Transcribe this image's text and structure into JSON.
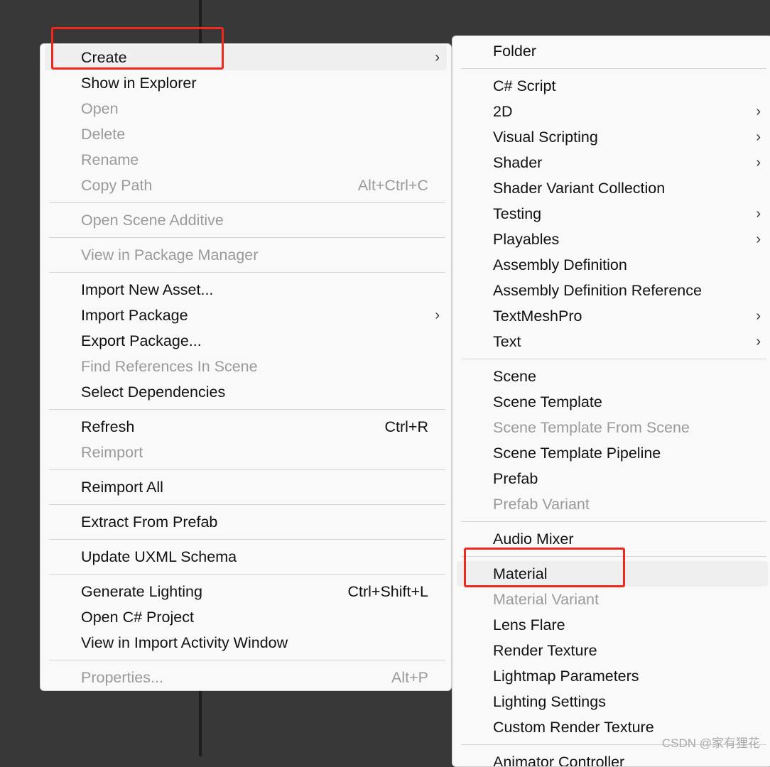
{
  "left_menu": {
    "items": [
      {
        "label": "Create",
        "arrow": true,
        "highlight": true
      },
      {
        "label": "Show in Explorer"
      },
      {
        "label": "Open",
        "disabled": true
      },
      {
        "label": "Delete",
        "disabled": true
      },
      {
        "label": "Rename",
        "disabled": true
      },
      {
        "label": "Copy Path",
        "shortcut": "Alt+Ctrl+C",
        "disabled": true
      },
      {
        "sep": true
      },
      {
        "label": "Open Scene Additive",
        "disabled": true
      },
      {
        "sep": true
      },
      {
        "label": "View in Package Manager",
        "disabled": true
      },
      {
        "sep": true
      },
      {
        "label": "Import New Asset..."
      },
      {
        "label": "Import Package",
        "arrow": true
      },
      {
        "label": "Export Package..."
      },
      {
        "label": "Find References In Scene",
        "disabled": true
      },
      {
        "label": "Select Dependencies"
      },
      {
        "sep": true
      },
      {
        "label": "Refresh",
        "shortcut": "Ctrl+R"
      },
      {
        "label": "Reimport",
        "disabled": true
      },
      {
        "sep": true
      },
      {
        "label": "Reimport All"
      },
      {
        "sep": true
      },
      {
        "label": "Extract From Prefab"
      },
      {
        "sep": true
      },
      {
        "label": "Update UXML Schema"
      },
      {
        "sep": true
      },
      {
        "label": "Generate Lighting",
        "shortcut": "Ctrl+Shift+L"
      },
      {
        "label": "Open C# Project"
      },
      {
        "label": "View in Import Activity Window"
      },
      {
        "sep": true
      },
      {
        "label": "Properties...",
        "shortcut": "Alt+P",
        "disabled": true
      }
    ]
  },
  "create_submenu": {
    "items": [
      {
        "label": "Folder"
      },
      {
        "sep": true
      },
      {
        "label": "C# Script"
      },
      {
        "label": "2D",
        "arrow": true
      },
      {
        "label": "Visual Scripting",
        "arrow": true
      },
      {
        "label": "Shader",
        "arrow": true
      },
      {
        "label": "Shader Variant Collection"
      },
      {
        "label": "Testing",
        "arrow": true
      },
      {
        "label": "Playables",
        "arrow": true
      },
      {
        "label": "Assembly Definition"
      },
      {
        "label": "Assembly Definition Reference"
      },
      {
        "label": "TextMeshPro",
        "arrow": true
      },
      {
        "label": "Text",
        "arrow": true
      },
      {
        "sep": true
      },
      {
        "label": "Scene"
      },
      {
        "label": "Scene Template"
      },
      {
        "label": "Scene Template From Scene",
        "disabled": true
      },
      {
        "label": "Scene Template Pipeline"
      },
      {
        "label": "Prefab"
      },
      {
        "label": "Prefab Variant",
        "disabled": true
      },
      {
        "sep": true
      },
      {
        "label": "Audio Mixer"
      },
      {
        "sep": true
      },
      {
        "label": "Material",
        "highlight": true
      },
      {
        "label": "Material Variant",
        "disabled": true
      },
      {
        "label": "Lens Flare"
      },
      {
        "label": "Render Texture"
      },
      {
        "label": "Lightmap Parameters"
      },
      {
        "label": "Lighting Settings"
      },
      {
        "label": "Custom Render Texture"
      },
      {
        "sep": true
      },
      {
        "label": "Animator Controller"
      }
    ]
  },
  "arrow_glyph": "›",
  "watermark": "CSDN @家有狸花",
  "colors": {
    "background": "#383838",
    "menu": "#f9f9f9",
    "highlight": "#efefef",
    "annotation": "#f0281e",
    "disabled": "#9a9a9a"
  }
}
